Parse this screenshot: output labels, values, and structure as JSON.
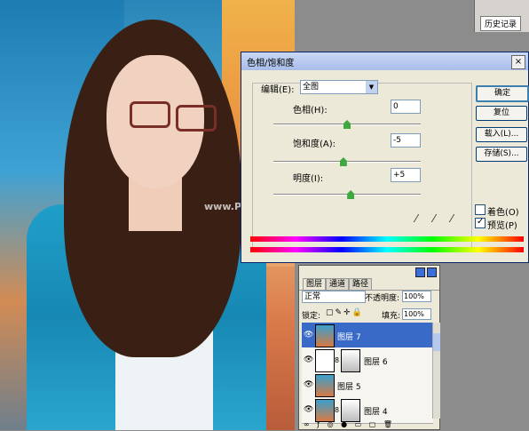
{
  "photo": {
    "watermark": "www.Prtoms.NET"
  },
  "history": {
    "tab_label": "历史记录"
  },
  "dialog": {
    "title": "色相/饱和度",
    "close_glyph": "×",
    "edit_label": "编辑(E):",
    "edit_value": "全图",
    "hue_label": "色相(H):",
    "hue_value": "0",
    "saturation_label": "饱和度(A):",
    "saturation_value": "-5",
    "lightness_label": "明度(I):",
    "lightness_value": "+5",
    "ok_label": "确定",
    "reset_label": "复位",
    "load_label": "载入(L)...",
    "save_label": "存储(S)...",
    "colorize_label": "着色(O)",
    "preview_label": "预览(P)",
    "preview_checked": true,
    "colorize_checked": false,
    "slider_levels": {
      "hue": 0,
      "saturation": -5,
      "lightness": 5
    }
  },
  "layers_panel": {
    "tabs": [
      "图层",
      "通道",
      "路径"
    ],
    "blend_mode": "正常",
    "opacity_label": "不透明度:",
    "opacity_value": "100%",
    "lock_label": "锁定:",
    "fill_label": "填充:",
    "fill_value": "100%",
    "layers": [
      {
        "name": "图层 7",
        "selected": true,
        "mask": false
      },
      {
        "name": "图层 6",
        "selected": false,
        "mask": true
      },
      {
        "name": "图层 5",
        "selected": false,
        "mask": false
      },
      {
        "name": "图层 4",
        "selected": false,
        "mask": true
      }
    ]
  }
}
